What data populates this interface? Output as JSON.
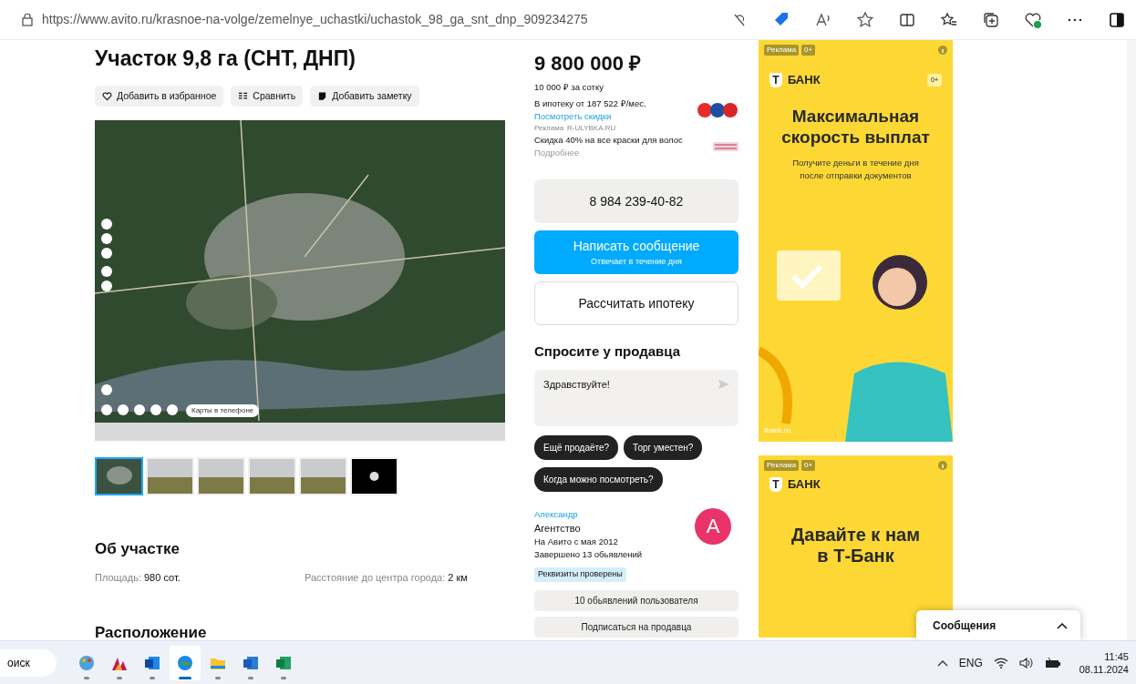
{
  "browser": {
    "url": "https://www.avito.ru/krasnoe-na-volge/zemelnye_uchastki/uchastok_98_ga_snt_dnp_909234275"
  },
  "listing": {
    "title": "Участок 9,8 га (СНТ, ДНП)",
    "actions": [
      {
        "label": "Добавить в избранное",
        "kind": "heart"
      },
      {
        "label": "Сравнить",
        "kind": "compare"
      },
      {
        "label": "Добавить заметку",
        "kind": "note"
      }
    ],
    "map": {
      "apps_label": "Карты в телефоне"
    },
    "thumbnails": [
      {
        "kind": "map",
        "selected": true
      },
      {
        "kind": "photo",
        "selected": false
      },
      {
        "kind": "photo",
        "selected": false
      },
      {
        "kind": "photo",
        "selected": false
      },
      {
        "kind": "photo",
        "selected": false
      },
      {
        "kind": "more",
        "selected": false
      }
    ],
    "about": {
      "heading": "Об участке",
      "params": [
        {
          "label": "Площадь:",
          "value": "980 сот."
        },
        {
          "label": "Расстояние до центра города:",
          "value": "2 км"
        }
      ]
    },
    "location_heading": "Расположение"
  },
  "price": {
    "amount": "9 800 000 ₽",
    "per_unit": "10 000 ₽ за сотку",
    "mortgage": "В ипотеку от 187 522 ₽/мес.",
    "discounts_link": "Посмотреть скидки"
  },
  "promo": {
    "tag": "Реклама",
    "domain": "R-ULYBKA.RU",
    "text": "Скидка 40% на все краски для волос",
    "more": "Подробнее"
  },
  "phone": "8 984 239-40-82",
  "message_button": {
    "label": "Написать сообщение",
    "sub": "Отвечает в течение дня"
  },
  "mortgage_button": "Рассчитать ипотеку",
  "ask": {
    "heading": "Спросите у продавца",
    "message": "Здравствуйте!",
    "quick_replies": [
      "Ещё продаёте?",
      "Торг уместен?",
      "Когда можно посмотреть?"
    ]
  },
  "seller": {
    "name": "Александр",
    "type": "Агентство",
    "since": "На Авито с мая 2012",
    "completed": "Завершено 13 обьявлений",
    "badge": "Реквизиты проверены",
    "avatar_letter": "А",
    "buttons": [
      "10 обьявлений пользователя",
      "Подписаться на продавца"
    ]
  },
  "ads": [
    {
      "tag": "Реклама",
      "age": "0+",
      "logo_letter": "Т",
      "brand": "БАНК",
      "badge": "0+",
      "headline": "Максимальная скорость выплат",
      "text": "Получите деньги в течение дня после отправки документов",
      "domain": "tbank.ru"
    },
    {
      "tag": "Реклама",
      "age": "0+",
      "logo_letter": "Т",
      "brand": "БАНК",
      "headline": "Давайте к нам в Т-Банк"
    }
  ],
  "messages_panel": {
    "title": "Сообщения"
  },
  "taskbar": {
    "search": "оиск",
    "apps": [
      {
        "kind": "palette",
        "selected": false
      },
      {
        "kind": "triangles",
        "selected": false
      },
      {
        "kind": "mail",
        "selected": false
      },
      {
        "kind": "browser",
        "selected": true
      },
      {
        "kind": "folder",
        "selected": false
      },
      {
        "kind": "document",
        "selected": false
      },
      {
        "kind": "spreadsheet",
        "selected": false
      }
    ],
    "lang": "ENG",
    "time": "11:45",
    "date": "08.11.2024"
  }
}
